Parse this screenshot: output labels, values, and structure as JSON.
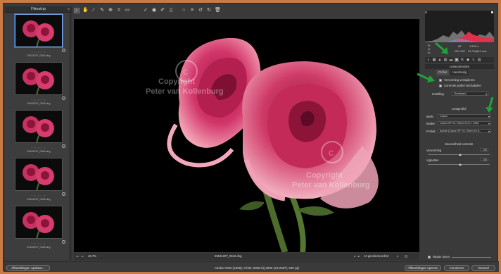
{
  "filmstrip": {
    "title": "Filmstrip",
    "menu_icon": "menu-icon",
    "thumbs": [
      {
        "name": "20181207_0942.dng",
        "stars": "• • • • •",
        "selected": true
      },
      {
        "name": "20181207_0943.dng",
        "stars": "• • • • •"
      },
      {
        "name": "20181207_0944.dng",
        "stars": "• • • • •"
      },
      {
        "name": "20181207_0945.dng",
        "stars": "• • • • •"
      },
      {
        "name": "20181207_0946.dng",
        "stars": "• • • • •"
      }
    ]
  },
  "toolbar": {
    "icons": [
      "zoom-icon",
      "hand-icon",
      "white-balance-icon",
      "color-sampler-icon",
      "target-adjust-icon",
      "crop-icon",
      "straighten-icon",
      "spot-removal-icon",
      "red-eye-icon",
      "brush-icon",
      "graduated-filter-icon",
      "radial-filter-icon",
      "preferences-icon",
      "rotate-left-icon",
      "rotate-right-icon",
      "trash-icon"
    ]
  },
  "viewer": {
    "watermark_line1": "Copyright",
    "watermark_line2": "Peter van Kollenburg",
    "zoom": "46,7%",
    "filename": "20181207_0942.dng",
    "selected_count": "12 geselecteerd/12"
  },
  "panel": {
    "info": {
      "r_label": "R:",
      "g_label": "G:",
      "b_label": "B:",
      "aperture": "f/8",
      "shutter": "1/125 s",
      "iso": "ISO 100",
      "lens": "24-70@42 mm"
    },
    "section_title": "Lenscorrecties",
    "subtabs": [
      "Profiel",
      "Handmatig"
    ],
    "checkbox1": "Vervorming verwijderen",
    "checkbox2": "Correctie profiel inschakelen",
    "instelling_label": "Instelling:",
    "instelling_value": "Standaard",
    "lensprofiel_title": "Lensprofiel",
    "merk_label": "Merk:",
    "merk_value": "Canon",
    "model_label": "Model:",
    "model_value": "Canon EF 24-70mm f/2.8 L USM",
    "profiel_label": "Profiel:",
    "profiel_value": "Adobe (Canon EF 24-70mm f/2.8...",
    "hoeveelheid_title": "Hoeveelheid correctie",
    "vervorming_label": "Vervorming",
    "vervorming_value": "100",
    "vignetten_label": "Vignetten",
    "vignetten_value": "100",
    "raster_label": "Raster tonen",
    "raster_value": "—"
  },
  "bottom": {
    "open_images": "Afbeeldingen opslaan...",
    "info": "Adobe RGB (1998); 8 bits; 6000 bij 4000 (24,0MP); 300 ppi",
    "open_button": "Afbeeldingen openen",
    "cancel_button": "Annuleren",
    "done_button": "Gereed"
  },
  "colors": {
    "annotation_arrow": "#1fa23a",
    "frame_border": "#c97a45",
    "rose": "#d2356a"
  }
}
